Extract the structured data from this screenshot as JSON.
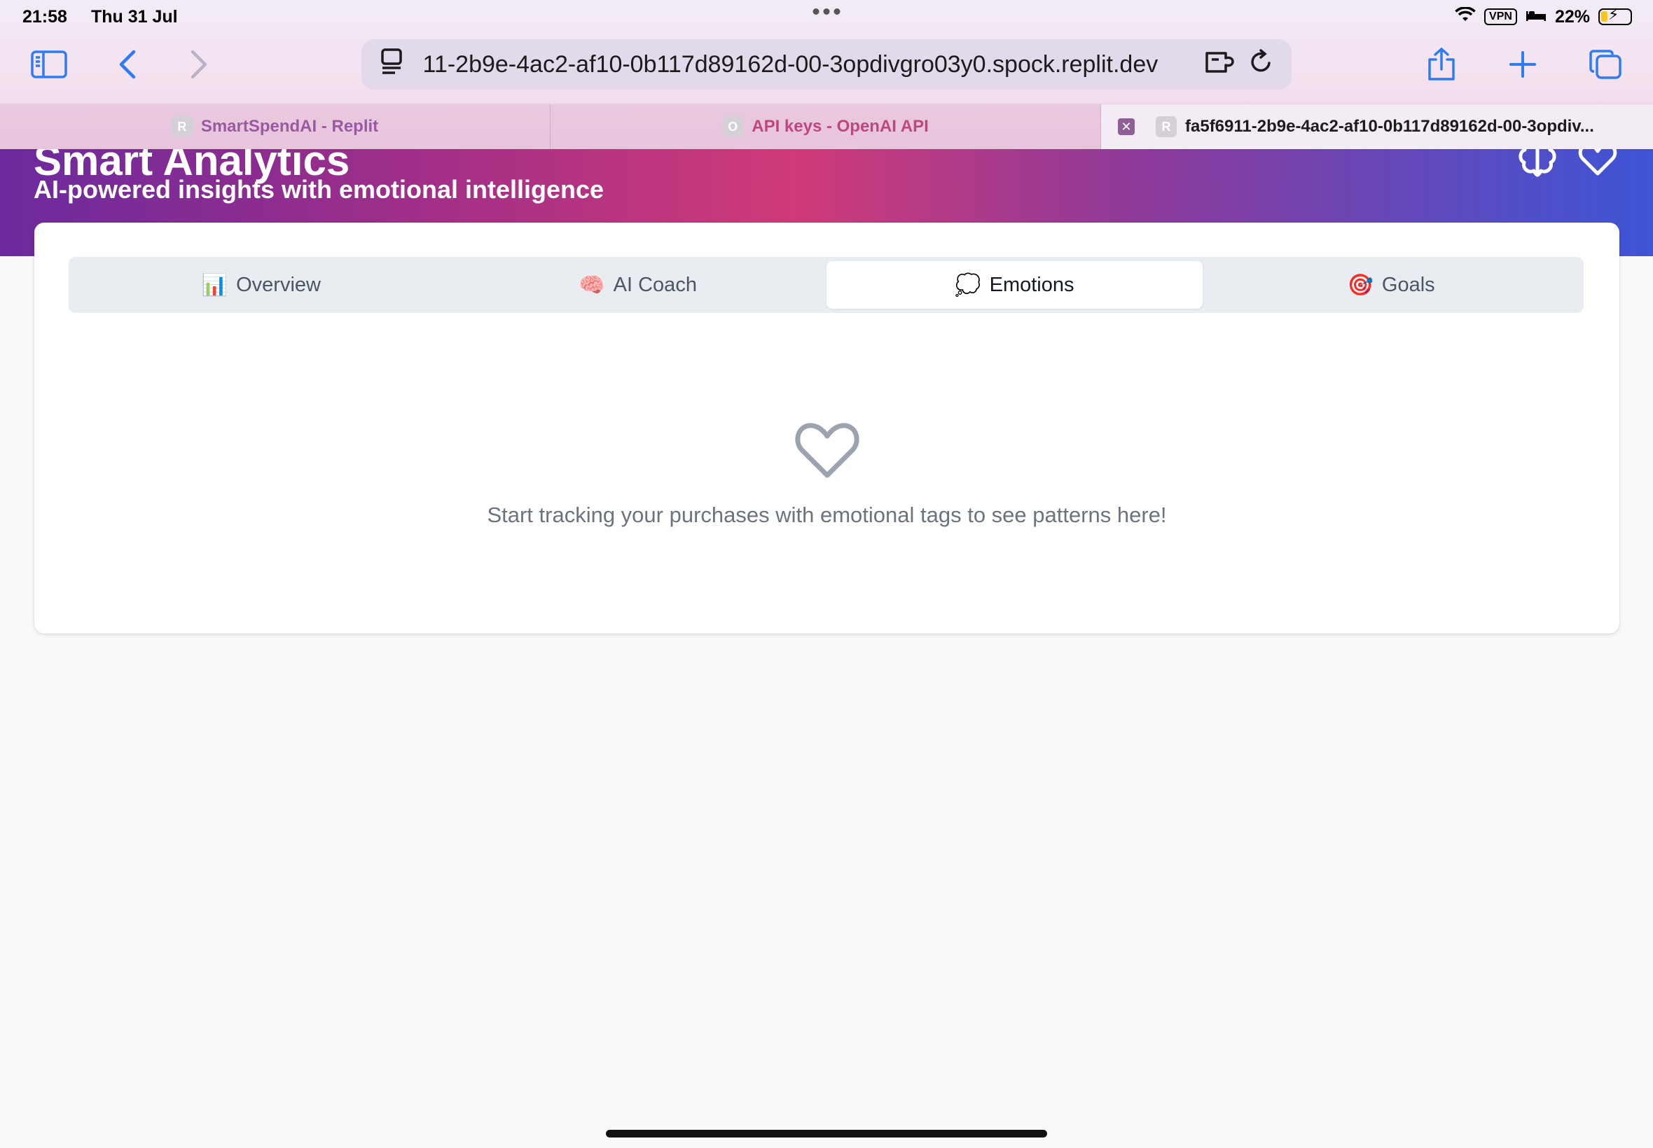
{
  "status_bar": {
    "time": "21:58",
    "date": "Thu 31 Jul",
    "vpn": "VPN",
    "battery": "22%"
  },
  "browser": {
    "url": " 11-2b9e-4ac2-af10-0b117d89162d-00-3opdivgro03y0.spock.replit.dev",
    "tabs": [
      {
        "label": "SmartSpendAI - Replit",
        "favicon": "R"
      },
      {
        "label": "API keys - OpenAI API",
        "favicon": "O"
      },
      {
        "label": "fa5f6911-2b9e-4ac2-af10-0b117d89162d-00-3opdiv...",
        "favicon": "R"
      }
    ]
  },
  "hero": {
    "title": "Smart Analytics",
    "subtitle": "AI-powered insights with emotional intelligence"
  },
  "segments": [
    {
      "label": "Overview",
      "emoji": "📊"
    },
    {
      "label": "AI Coach",
      "emoji": "🧠"
    },
    {
      "label": "Emotions",
      "emoji": "💭"
    },
    {
      "label": "Goals",
      "emoji": "🎯"
    }
  ],
  "active_segment": "Emotions",
  "empty_state": {
    "message": "Start tracking your purchases with emotional tags to see patterns here!"
  },
  "colors": {
    "accent": "#2d7cf6",
    "hero_start": "#6c2a9e",
    "hero_mid": "#cf3a78",
    "hero_end": "#3d55d6"
  }
}
